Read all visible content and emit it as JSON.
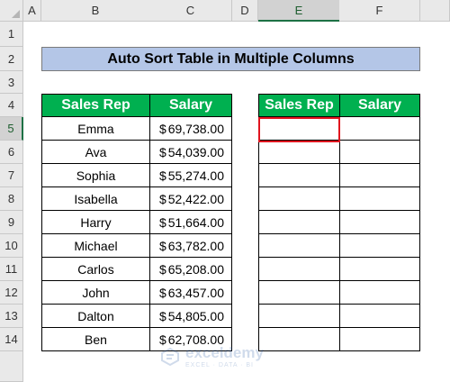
{
  "columns": [
    "A",
    "B",
    "C",
    "D",
    "E",
    "F"
  ],
  "rows": [
    "1",
    "2",
    "3",
    "4",
    "5",
    "6",
    "7",
    "8",
    "9",
    "10",
    "11",
    "12",
    "13",
    "14"
  ],
  "selected_column": "E",
  "selected_row": "5",
  "title": "Auto Sort Table in Multiple Columns",
  "source_table": {
    "headers": [
      "Sales Rep",
      "Salary"
    ],
    "currency_symbol": "$",
    "rows": [
      {
        "name": "Emma",
        "salary": "69,738.00"
      },
      {
        "name": "Ava",
        "salary": "54,039.00"
      },
      {
        "name": "Sophia",
        "salary": "55,274.00"
      },
      {
        "name": "Isabella",
        "salary": "52,422.00"
      },
      {
        "name": "Harry",
        "salary": "51,664.00"
      },
      {
        "name": "Michael",
        "salary": "63,782.00"
      },
      {
        "name": "Carlos",
        "salary": "65,208.00"
      },
      {
        "name": "John",
        "salary": "63,457.00"
      },
      {
        "name": "Dalton",
        "salary": "54,805.00"
      },
      {
        "name": "Ben",
        "salary": "62,708.00"
      }
    ]
  },
  "sorted_table": {
    "headers": [
      "Sales Rep",
      "Salary"
    ]
  },
  "watermark": {
    "name": "exceldemy",
    "tagline": "EXCEL · DATA · BI"
  },
  "colors": {
    "header_green": "#00b050",
    "title_blue": "#b4c6e7",
    "active_border": "#e0141e"
  }
}
